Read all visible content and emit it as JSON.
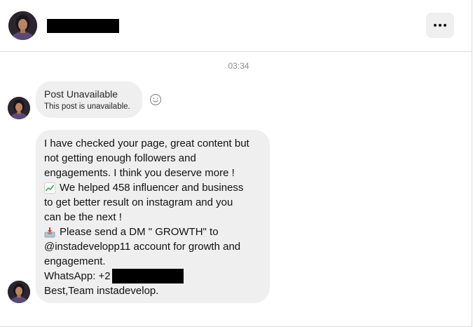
{
  "header": {
    "avatar_icon": "profile-avatar",
    "name_redacted": true,
    "more_icon": "more-options-icon"
  },
  "conversation": {
    "timestamp": "03:34",
    "messages": [
      {
        "type": "post",
        "title": "Post Unavailable",
        "subtitle": "This post is unavailable.",
        "reaction_icon": "smiley-face-icon"
      },
      {
        "type": "text",
        "lines": {
          "l1": "I have checked your page, great content but",
          "l2": "not getting enough followers and",
          "l3": "engagements. I think you deserve more !",
          "l4": "We helped 458 influencer and business",
          "l5": "to get better result on instagram and you",
          "l6": "can be the next !",
          "l7": "Please send a DM \" GROWTH\" to",
          "l8": "@instadevelopp11 account for growth and",
          "l9": "engagement.",
          "l10": "WhatsApp: +2",
          "l11": "Best,Team instadevelop."
        },
        "emoji_chart": "chart-increasing-icon",
        "emoji_inbox": "inbox-tray-icon",
        "phone_redacted": true
      }
    ]
  },
  "colors": {
    "bubble": "#efefef",
    "border": "#dbdbdb",
    "timestamp": "#8e8e8e"
  }
}
